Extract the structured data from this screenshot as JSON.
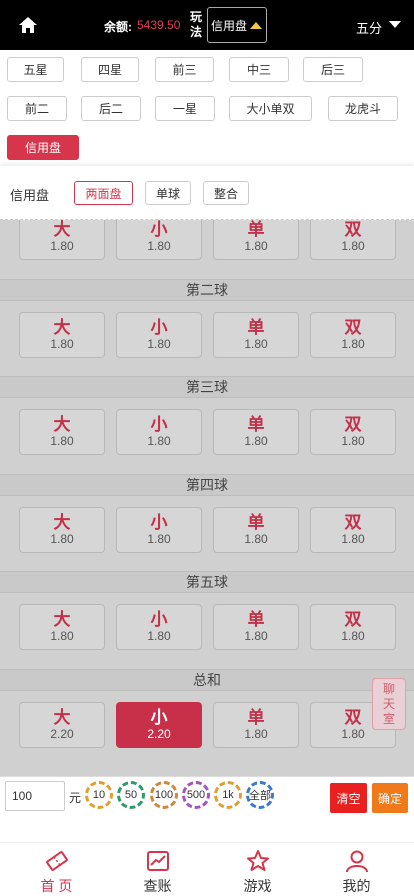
{
  "header": {
    "balance_label": "余额:",
    "balance_value": "5439.50",
    "play_label": "玩法",
    "play_value": "信用盘",
    "unit": "五分"
  },
  "play_types": [
    "五星",
    "四星",
    "前三",
    "中三",
    "后三",
    "前二",
    "后二",
    "一星",
    "大小单双",
    "龙虎斗",
    "信用盘"
  ],
  "active_play_type": "信用盘",
  "sub": {
    "title": "信用盘",
    "tabs": [
      "两面盘",
      "单球",
      "整合"
    ],
    "active_tab": "两面盘"
  },
  "sections": [
    {
      "title": "",
      "options": [
        {
          "name": "大",
          "odds": "1.80"
        },
        {
          "name": "小",
          "odds": "1.80"
        },
        {
          "name": "单",
          "odds": "1.80"
        },
        {
          "name": "双",
          "odds": "1.80"
        }
      ]
    },
    {
      "title": "第二球",
      "options": [
        {
          "name": "大",
          "odds": "1.80"
        },
        {
          "name": "小",
          "odds": "1.80"
        },
        {
          "name": "单",
          "odds": "1.80"
        },
        {
          "name": "双",
          "odds": "1.80"
        }
      ]
    },
    {
      "title": "第三球",
      "options": [
        {
          "name": "大",
          "odds": "1.80"
        },
        {
          "name": "小",
          "odds": "1.80"
        },
        {
          "name": "单",
          "odds": "1.80"
        },
        {
          "name": "双",
          "odds": "1.80"
        }
      ]
    },
    {
      "title": "第四球",
      "options": [
        {
          "name": "大",
          "odds": "1.80"
        },
        {
          "name": "小",
          "odds": "1.80"
        },
        {
          "name": "单",
          "odds": "1.80"
        },
        {
          "name": "双",
          "odds": "1.80"
        }
      ]
    },
    {
      "title": "第五球",
      "options": [
        {
          "name": "大",
          "odds": "1.80"
        },
        {
          "name": "小",
          "odds": "1.80"
        },
        {
          "name": "单",
          "odds": "1.80"
        },
        {
          "name": "双",
          "odds": "1.80"
        }
      ]
    },
    {
      "title": "总和",
      "options": [
        {
          "name": "大",
          "odds": "2.20"
        },
        {
          "name": "小",
          "odds": "2.20",
          "selected": true
        },
        {
          "name": "单",
          "odds": "1.80"
        },
        {
          "name": "双",
          "odds": "1.80"
        }
      ]
    }
  ],
  "chat_label": "聊天室",
  "bet": {
    "amount": "100",
    "unit": "元",
    "chips": [
      {
        "label": "10",
        "color": "#e0a030"
      },
      {
        "label": "50",
        "color": "#2f9a6a"
      },
      {
        "label": "100",
        "color": "#d0883a"
      },
      {
        "label": "500",
        "color": "#a055c0"
      },
      {
        "label": "1k",
        "color": "#e0a030"
      },
      {
        "label": "全部",
        "color": "#3a7ac8"
      }
    ],
    "clear_label": "清空",
    "confirm_label": "确定"
  },
  "nav": [
    {
      "label": "首 页",
      "icon": "ticket-icon",
      "active": true
    },
    {
      "label": "查账",
      "icon": "chart-icon"
    },
    {
      "label": "游戏",
      "icon": "star-icon"
    },
    {
      "label": "我的",
      "icon": "user-icon"
    }
  ],
  "colors": {
    "accent": "#d7354b",
    "clear": "#e8201e",
    "confirm": "#f07a1a"
  }
}
